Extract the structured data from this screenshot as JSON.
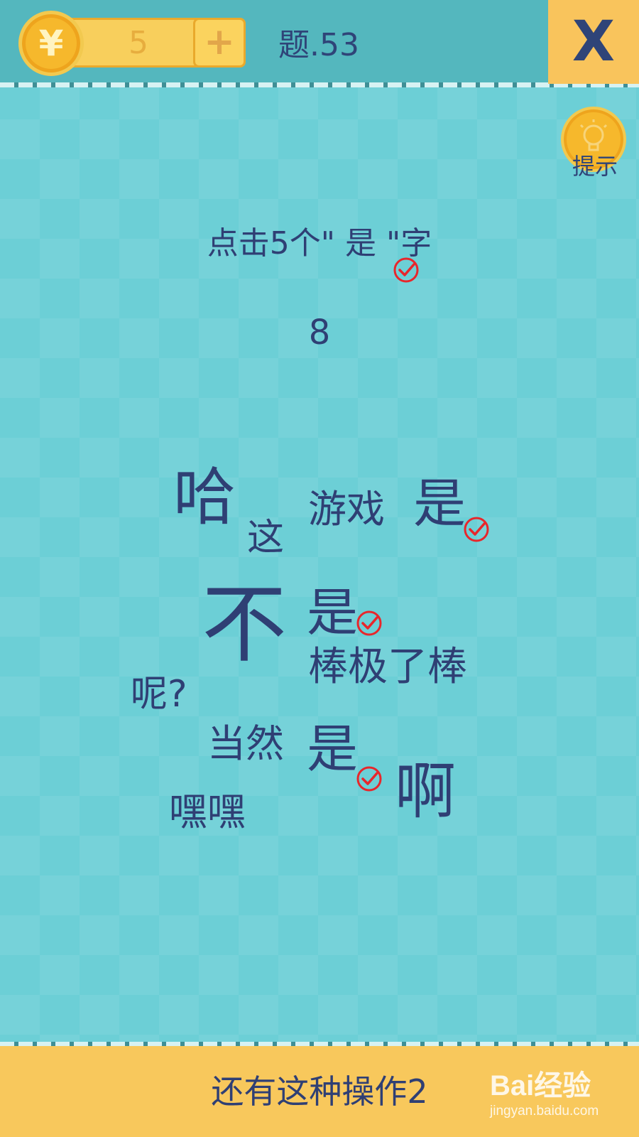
{
  "header": {
    "coin_symbol": "¥",
    "coin_count": "5",
    "plus_symbol": "+",
    "level_title": "题.53",
    "close_symbol": "X"
  },
  "hint": {
    "label": "提示",
    "icon": "lightbulb-icon"
  },
  "question": {
    "text": "点击5个\" 是 \"字",
    "counter": "8"
  },
  "words": [
    {
      "text": "哈"
    },
    {
      "text": "这"
    },
    {
      "text": "游戏"
    },
    {
      "text": "是"
    },
    {
      "text": "不"
    },
    {
      "text": "是"
    },
    {
      "text": "棒极了棒"
    },
    {
      "text": "呢?"
    },
    {
      "text": "当然"
    },
    {
      "text": "是"
    },
    {
      "text": "啊"
    },
    {
      "text": "嘿嘿"
    }
  ],
  "footer": {
    "text": "还有这种操作2"
  },
  "watermark": {
    "brand": "Bai经验",
    "url": "jingyan.baidu.com"
  },
  "colors": {
    "background": "#6ccfd6",
    "top_bar": "#54b7be",
    "gold": "#f8c85c",
    "text": "#2f3f74",
    "check": "#e8262b"
  }
}
